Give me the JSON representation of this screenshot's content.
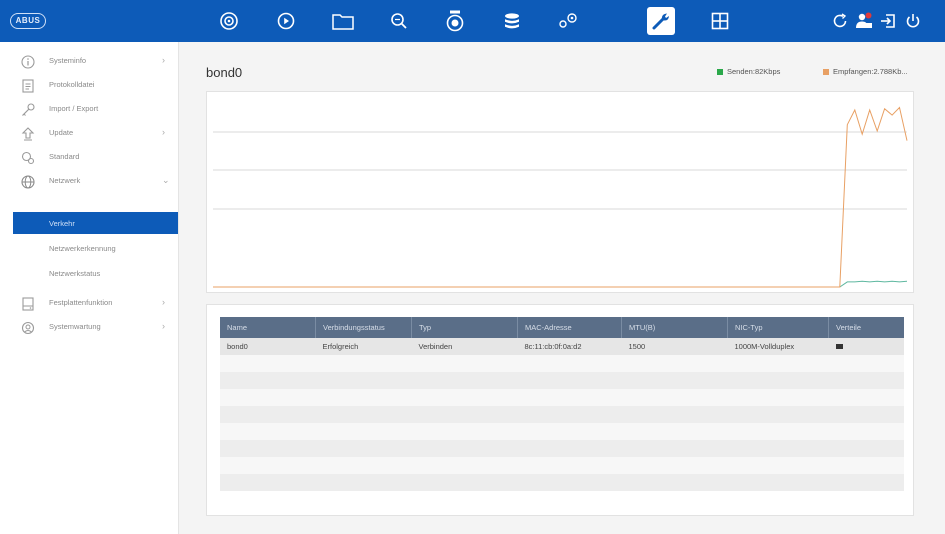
{
  "topbar": {
    "logo": "ABUS",
    "nav_icons": [
      "camera-icon",
      "play-icon",
      "folder-icon",
      "search-icon",
      "ptz-camera-icon",
      "database-icon",
      "gears-icon",
      "wrench-icon",
      "grid-icon"
    ],
    "active_icon": "wrench-icon",
    "right_icons": [
      "refresh-icon",
      "user-alert-icon",
      "logout-icon",
      "power-icon"
    ]
  },
  "sidebar": {
    "items": [
      {
        "label": "Systeminfo",
        "icon": "info-icon",
        "has_chevron": true
      },
      {
        "label": "Protokolldatei",
        "icon": "document-icon",
        "has_chevron": false
      },
      {
        "label": "Import / Export",
        "icon": "key-icon",
        "has_chevron": false
      },
      {
        "label": "Update",
        "icon": "upload-icon",
        "has_chevron": true
      },
      {
        "label": "Standard",
        "icon": "reset-icon",
        "has_chevron": false
      },
      {
        "label": "Netzwerk",
        "icon": "globe-icon",
        "has_chevron": true,
        "expanded": true
      },
      {
        "label": "Festplattenfunktion",
        "icon": "hdd-icon",
        "has_chevron": true
      },
      {
        "label": "Systemwartung",
        "icon": "maintenance-icon",
        "has_chevron": true
      }
    ],
    "subitems": [
      {
        "label": "Verkehr",
        "selected": true
      },
      {
        "label": "Netzwerkerkennung",
        "selected": false
      },
      {
        "label": "Netzwerkstatus",
        "selected": false
      }
    ]
  },
  "main": {
    "title": "bond0",
    "legend": [
      {
        "label": "Senden:82Kbps",
        "color": "#2aa84a"
      },
      {
        "label": "Empfangen:2.788Kb...",
        "color": "#e8a064"
      }
    ]
  },
  "chart_data": {
    "type": "line",
    "title": "",
    "xlabel": "",
    "ylabel": "",
    "grid": true,
    "series": [
      {
        "name": "Senden:82Kbps",
        "color": "#5fb8a0",
        "values": [
          0,
          0,
          0,
          0,
          0,
          0,
          0,
          0,
          0,
          0,
          0,
          0,
          0,
          0,
          0,
          0,
          0,
          0,
          0,
          0,
          0,
          0,
          0,
          0,
          0,
          0,
          0,
          0,
          0,
          0,
          0,
          0,
          0,
          0,
          0,
          0,
          0,
          0,
          0,
          0,
          0,
          0,
          0,
          0,
          0,
          0,
          0,
          0,
          0,
          0,
          0,
          0,
          0,
          0,
          0,
          0,
          0,
          0,
          0,
          0,
          0,
          0,
          0,
          0,
          0,
          0,
          0,
          0,
          0,
          0,
          0,
          0,
          0,
          0,
          0,
          0,
          0,
          0,
          0,
          0,
          0,
          0,
          0,
          0,
          0,
          0.08,
          0.08,
          0.09,
          0.08,
          0.09,
          0.08,
          0.09,
          0.08,
          0.09
        ]
      },
      {
        "name": "Empfangen:2.788Kb...",
        "color": "#e8a064",
        "values": [
          0,
          0,
          0,
          0,
          0,
          0,
          0,
          0,
          0,
          0,
          0,
          0,
          0,
          0,
          0,
          0,
          0,
          0,
          0,
          0,
          0,
          0,
          0,
          0,
          0,
          0,
          0,
          0,
          0,
          0,
          0,
          0,
          0,
          0,
          0,
          0,
          0,
          0,
          0,
          0,
          0,
          0,
          0,
          0,
          0,
          0,
          0,
          0,
          0,
          0,
          0,
          0,
          0,
          0,
          0,
          0,
          0,
          0,
          0,
          0,
          0,
          0,
          0,
          0,
          0,
          0,
          0,
          0,
          0,
          0,
          0,
          0,
          0,
          0,
          0,
          0,
          0,
          0,
          0,
          0,
          0,
          0,
          0,
          0,
          0,
          2.55,
          2.78,
          2.4,
          2.78,
          2.45,
          2.8,
          2.7,
          2.82,
          2.3
        ]
      }
    ],
    "ylim": [
      0,
      3
    ]
  },
  "table": {
    "headers": [
      "Name",
      "Verbindungsstatus",
      "Typ",
      "MAC-Adresse",
      "MTU(B)",
      "NIC-Typ",
      "Verteile"
    ],
    "rows": [
      [
        "bond0",
        "Erfolgreich",
        "Verbinden",
        "8c:11:cb:0f:0a:d2",
        "1500",
        "1000M-Vollduplex",
        ""
      ]
    ],
    "empty_rows": 8
  }
}
